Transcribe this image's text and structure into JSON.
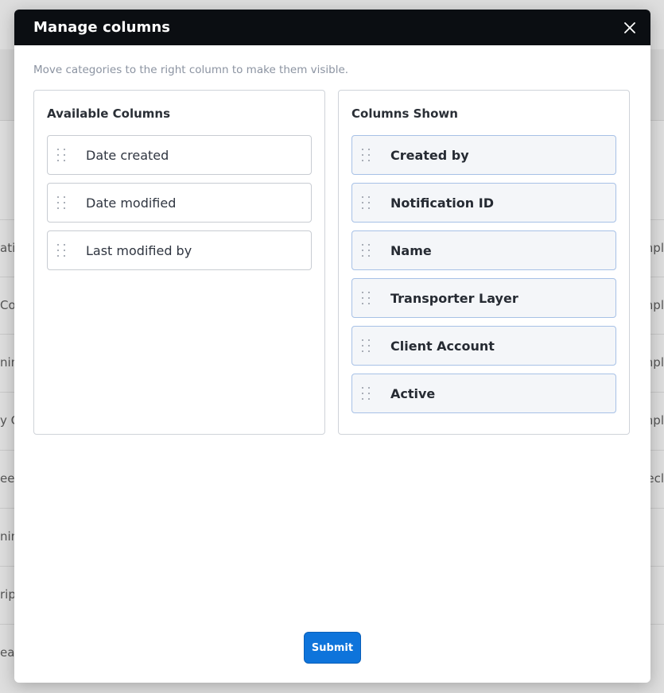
{
  "background": {
    "rows": [
      {
        "left": "ati",
        "right": "npl"
      },
      {
        "left": "Cor",
        "right": "npl"
      },
      {
        "left": "nim",
        "right": "npl"
      },
      {
        "left": "y C",
        "right": "npl"
      },
      {
        "left": "eep",
        "right": "ecl"
      },
      {
        "left": "nim",
        "right": ""
      },
      {
        "left": "ript",
        "right": ""
      },
      {
        "left": "eal-",
        "right": ""
      }
    ]
  },
  "modal": {
    "title": "Manage columns",
    "close_icon": "close-icon",
    "description": "Move categories to the right column to make them visible.",
    "available": {
      "title": "Available Columns",
      "items": [
        "Date created",
        "Date modified",
        "Last modified by"
      ]
    },
    "shown": {
      "title": "Columns Shown",
      "items": [
        "Created by",
        "Notification ID",
        "Name",
        "Transporter Layer",
        "Client Account",
        "Active"
      ]
    },
    "submit_label": "Submit"
  },
  "colors": {
    "header_bg": "#0b0e12",
    "accent": "#0e74db",
    "shown_item_bg": "#f4f6f9",
    "shown_item_border": "#a7c1e6"
  }
}
